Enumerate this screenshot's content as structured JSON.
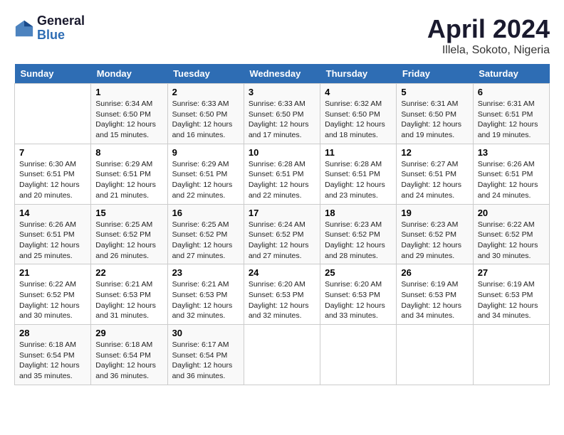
{
  "header": {
    "logo_general": "General",
    "logo_blue": "Blue",
    "title": "April 2024",
    "subtitle": "Illela, Sokoto, Nigeria"
  },
  "days_of_week": [
    "Sunday",
    "Monday",
    "Tuesday",
    "Wednesday",
    "Thursday",
    "Friday",
    "Saturday"
  ],
  "weeks": [
    [
      {
        "day": "",
        "info": ""
      },
      {
        "day": "1",
        "info": "Sunrise: 6:34 AM\nSunset: 6:50 PM\nDaylight: 12 hours\nand 15 minutes."
      },
      {
        "day": "2",
        "info": "Sunrise: 6:33 AM\nSunset: 6:50 PM\nDaylight: 12 hours\nand 16 minutes."
      },
      {
        "day": "3",
        "info": "Sunrise: 6:33 AM\nSunset: 6:50 PM\nDaylight: 12 hours\nand 17 minutes."
      },
      {
        "day": "4",
        "info": "Sunrise: 6:32 AM\nSunset: 6:50 PM\nDaylight: 12 hours\nand 18 minutes."
      },
      {
        "day": "5",
        "info": "Sunrise: 6:31 AM\nSunset: 6:50 PM\nDaylight: 12 hours\nand 19 minutes."
      },
      {
        "day": "6",
        "info": "Sunrise: 6:31 AM\nSunset: 6:51 PM\nDaylight: 12 hours\nand 19 minutes."
      }
    ],
    [
      {
        "day": "7",
        "info": "Sunrise: 6:30 AM\nSunset: 6:51 PM\nDaylight: 12 hours\nand 20 minutes."
      },
      {
        "day": "8",
        "info": "Sunrise: 6:29 AM\nSunset: 6:51 PM\nDaylight: 12 hours\nand 21 minutes."
      },
      {
        "day": "9",
        "info": "Sunrise: 6:29 AM\nSunset: 6:51 PM\nDaylight: 12 hours\nand 22 minutes."
      },
      {
        "day": "10",
        "info": "Sunrise: 6:28 AM\nSunset: 6:51 PM\nDaylight: 12 hours\nand 22 minutes."
      },
      {
        "day": "11",
        "info": "Sunrise: 6:28 AM\nSunset: 6:51 PM\nDaylight: 12 hours\nand 23 minutes."
      },
      {
        "day": "12",
        "info": "Sunrise: 6:27 AM\nSunset: 6:51 PM\nDaylight: 12 hours\nand 24 minutes."
      },
      {
        "day": "13",
        "info": "Sunrise: 6:26 AM\nSunset: 6:51 PM\nDaylight: 12 hours\nand 24 minutes."
      }
    ],
    [
      {
        "day": "14",
        "info": "Sunrise: 6:26 AM\nSunset: 6:51 PM\nDaylight: 12 hours\nand 25 minutes."
      },
      {
        "day": "15",
        "info": "Sunrise: 6:25 AM\nSunset: 6:52 PM\nDaylight: 12 hours\nand 26 minutes."
      },
      {
        "day": "16",
        "info": "Sunrise: 6:25 AM\nSunset: 6:52 PM\nDaylight: 12 hours\nand 27 minutes."
      },
      {
        "day": "17",
        "info": "Sunrise: 6:24 AM\nSunset: 6:52 PM\nDaylight: 12 hours\nand 27 minutes."
      },
      {
        "day": "18",
        "info": "Sunrise: 6:23 AM\nSunset: 6:52 PM\nDaylight: 12 hours\nand 28 minutes."
      },
      {
        "day": "19",
        "info": "Sunrise: 6:23 AM\nSunset: 6:52 PM\nDaylight: 12 hours\nand 29 minutes."
      },
      {
        "day": "20",
        "info": "Sunrise: 6:22 AM\nSunset: 6:52 PM\nDaylight: 12 hours\nand 30 minutes."
      }
    ],
    [
      {
        "day": "21",
        "info": "Sunrise: 6:22 AM\nSunset: 6:52 PM\nDaylight: 12 hours\nand 30 minutes."
      },
      {
        "day": "22",
        "info": "Sunrise: 6:21 AM\nSunset: 6:53 PM\nDaylight: 12 hours\nand 31 minutes."
      },
      {
        "day": "23",
        "info": "Sunrise: 6:21 AM\nSunset: 6:53 PM\nDaylight: 12 hours\nand 32 minutes."
      },
      {
        "day": "24",
        "info": "Sunrise: 6:20 AM\nSunset: 6:53 PM\nDaylight: 12 hours\nand 32 minutes."
      },
      {
        "day": "25",
        "info": "Sunrise: 6:20 AM\nSunset: 6:53 PM\nDaylight: 12 hours\nand 33 minutes."
      },
      {
        "day": "26",
        "info": "Sunrise: 6:19 AM\nSunset: 6:53 PM\nDaylight: 12 hours\nand 34 minutes."
      },
      {
        "day": "27",
        "info": "Sunrise: 6:19 AM\nSunset: 6:53 PM\nDaylight: 12 hours\nand 34 minutes."
      }
    ],
    [
      {
        "day": "28",
        "info": "Sunrise: 6:18 AM\nSunset: 6:54 PM\nDaylight: 12 hours\nand 35 minutes."
      },
      {
        "day": "29",
        "info": "Sunrise: 6:18 AM\nSunset: 6:54 PM\nDaylight: 12 hours\nand 36 minutes."
      },
      {
        "day": "30",
        "info": "Sunrise: 6:17 AM\nSunset: 6:54 PM\nDaylight: 12 hours\nand 36 minutes."
      },
      {
        "day": "",
        "info": ""
      },
      {
        "day": "",
        "info": ""
      },
      {
        "day": "",
        "info": ""
      },
      {
        "day": "",
        "info": ""
      }
    ]
  ]
}
